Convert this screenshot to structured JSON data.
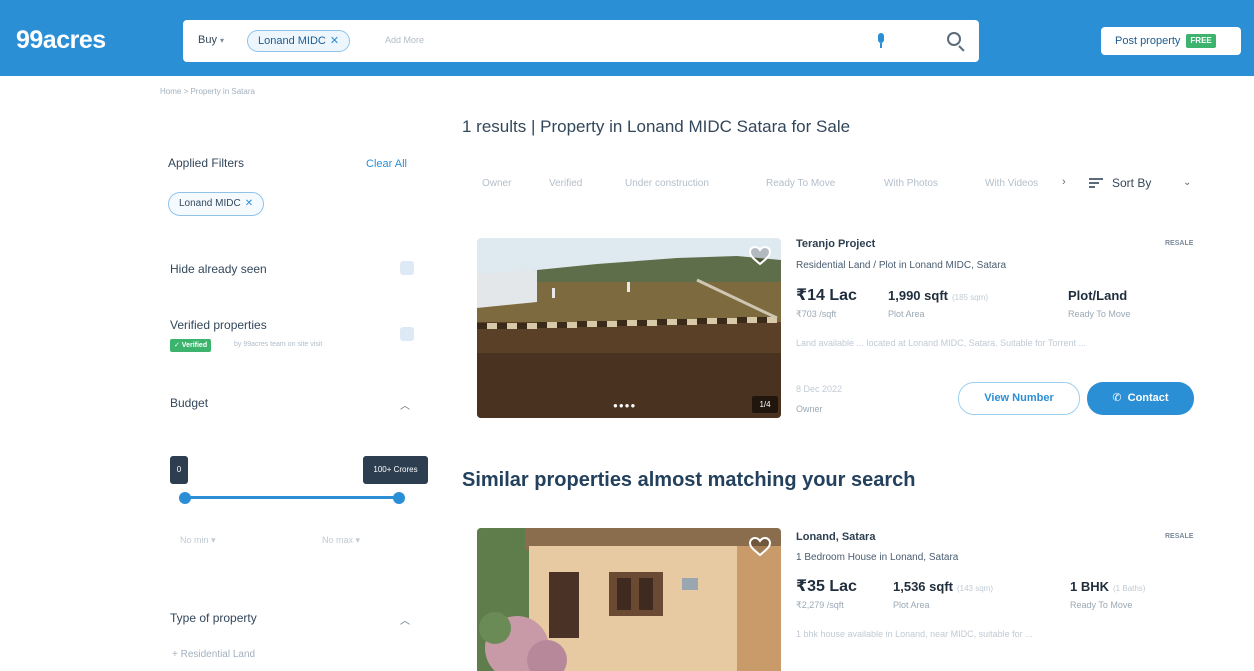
{
  "header": {
    "logo": "99acres",
    "search": {
      "buy_label": "Buy",
      "location_chip": "Lonand MIDC",
      "add_more_placeholder": "Add More"
    },
    "post_property": {
      "label": "Post property",
      "badge": "FREE"
    }
  },
  "sidebar": {
    "breadcrumb": "Home > Property in Satara",
    "applied_filters": {
      "title": "Applied Filters",
      "clear_all": "Clear All",
      "chip": "Lonand MIDC"
    },
    "hide_seen": {
      "label": "Hide already seen"
    },
    "verified": {
      "label": "Verified properties",
      "badge": "✓ Verified",
      "note": "by 99acres team on site visit"
    },
    "budget": {
      "title": "Budget",
      "min_label": "0",
      "max_label": "100+ Crores",
      "min_select": "No min",
      "max_select": "No max"
    },
    "type_of_property": {
      "title": "Type of property",
      "first_option": "+ Residential Land"
    }
  },
  "main": {
    "results_title": "1 results | Property in Lonand MIDC Satara for Sale",
    "quick_filters": [
      "Owner",
      "Verified",
      "Under construction",
      "Ready To Move",
      "With Photos",
      "With Videos"
    ],
    "sort_label": "Sort By",
    "listing": {
      "title": "Teranjo Project",
      "subtitle": "Residential Land / Plot in Lonand MIDC, Satara",
      "tag": "RESALE",
      "price": "₹14 Lac",
      "price_per_unit": "₹703 /sqft",
      "area": "1,990 sqft",
      "area_alt": "(185 sqm)",
      "area_label": "Plot Area",
      "type": "Plot/Land",
      "status": "Ready To Move",
      "description": "Land available ... located at Lonand MIDC, Satara. Suitable for Torrent ...",
      "posted": "8 Dec 2022",
      "posted_by": "Owner",
      "image_count": "1/4",
      "view_number": "View Number",
      "contact": "Contact"
    },
    "similar_title": "Similar properties almost matching your search",
    "similar": {
      "title": "Lonand, Satara",
      "subtitle": "1 Bedroom House in Lonand, Satara",
      "tag": "RESALE",
      "price": "₹35 Lac",
      "price_per_unit": "₹2,279 /sqft",
      "area": "1,536 sqft",
      "area_alt": "(143 sqm)",
      "area_label": "Plot Area",
      "type": "1 BHK",
      "type_alt": "(1 Baths)",
      "status": "Ready To Move",
      "description": "1 bhk house available in Lonand, near MIDC, suitable for ..."
    }
  }
}
